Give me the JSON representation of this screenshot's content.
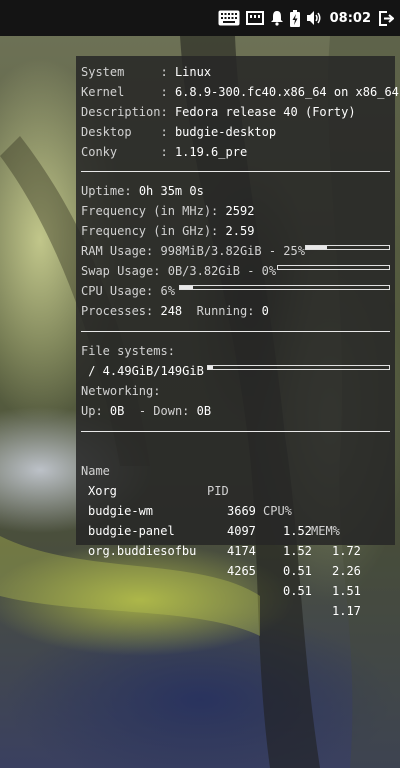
{
  "topbar": {
    "icons": [
      "keyboard-icon",
      "network-icon",
      "notification-bell-icon",
      "battery-icon",
      "volume-icon",
      "logout-icon"
    ],
    "clock": "08:02"
  },
  "conky": {
    "system": {
      "system_label": "System     :",
      "system_value": "Linux",
      "kernel_label": "Kernel     :",
      "kernel_value": "6.8.9-300.fc40.x86_64 on x86_64",
      "description_label": "Description:",
      "description_value": "Fedora release 40 (Forty)",
      "desktop_label": "Desktop    :",
      "desktop_value": "budgie-desktop",
      "conky_label": "Conky      :",
      "conky_value": "1.19.6_pre"
    },
    "stats": {
      "uptime_label": "Uptime:",
      "uptime_value": "0h 35m 0s",
      "freq_mhz_label": "Frequency (in MHz):",
      "freq_mhz_value": "2592",
      "freq_ghz_label": "Frequency (in GHz):",
      "freq_ghz_value": "2.59",
      "ram_label": "RAM Usage:",
      "ram_value": "998MiB/3.82GiB - 25%",
      "ram_fraction": 0.25,
      "swap_label": "Swap Usage:",
      "swap_value": "0B/3.82GiB - 0%",
      "swap_fraction": 0.0,
      "cpu_label": "CPU Usage:",
      "cpu_value": "6%",
      "cpu_fraction": 0.06,
      "processes_label": "Processes:",
      "processes_value": "248",
      "running_label": "Running:",
      "running_value": "0"
    },
    "filesystems": {
      "label": "File systems:",
      "root_value": " / 4.49GiB/149GiB",
      "root_fraction": 0.03,
      "networking_label": "Networking:",
      "up_label": "Up:",
      "up_value": "0B",
      "down_label": " - Down:",
      "down_value": "0B"
    },
    "processes": {
      "headers": [
        "Name",
        "PID",
        "CPU%",
        "MEM%"
      ],
      "rows": [
        {
          "name": "Xorg",
          "pid": "3669",
          "cpu": "1.52",
          "mem": "1.72"
        },
        {
          "name": "budgie-wm",
          "pid": "4097",
          "cpu": "1.52",
          "mem": "2.26"
        },
        {
          "name": "budgie-panel",
          "pid": "4174",
          "cpu": "0.51",
          "mem": "1.51"
        },
        {
          "name": "org.buddiesofbu",
          "pid": "4265",
          "cpu": "0.51",
          "mem": "1.17"
        }
      ]
    }
  }
}
